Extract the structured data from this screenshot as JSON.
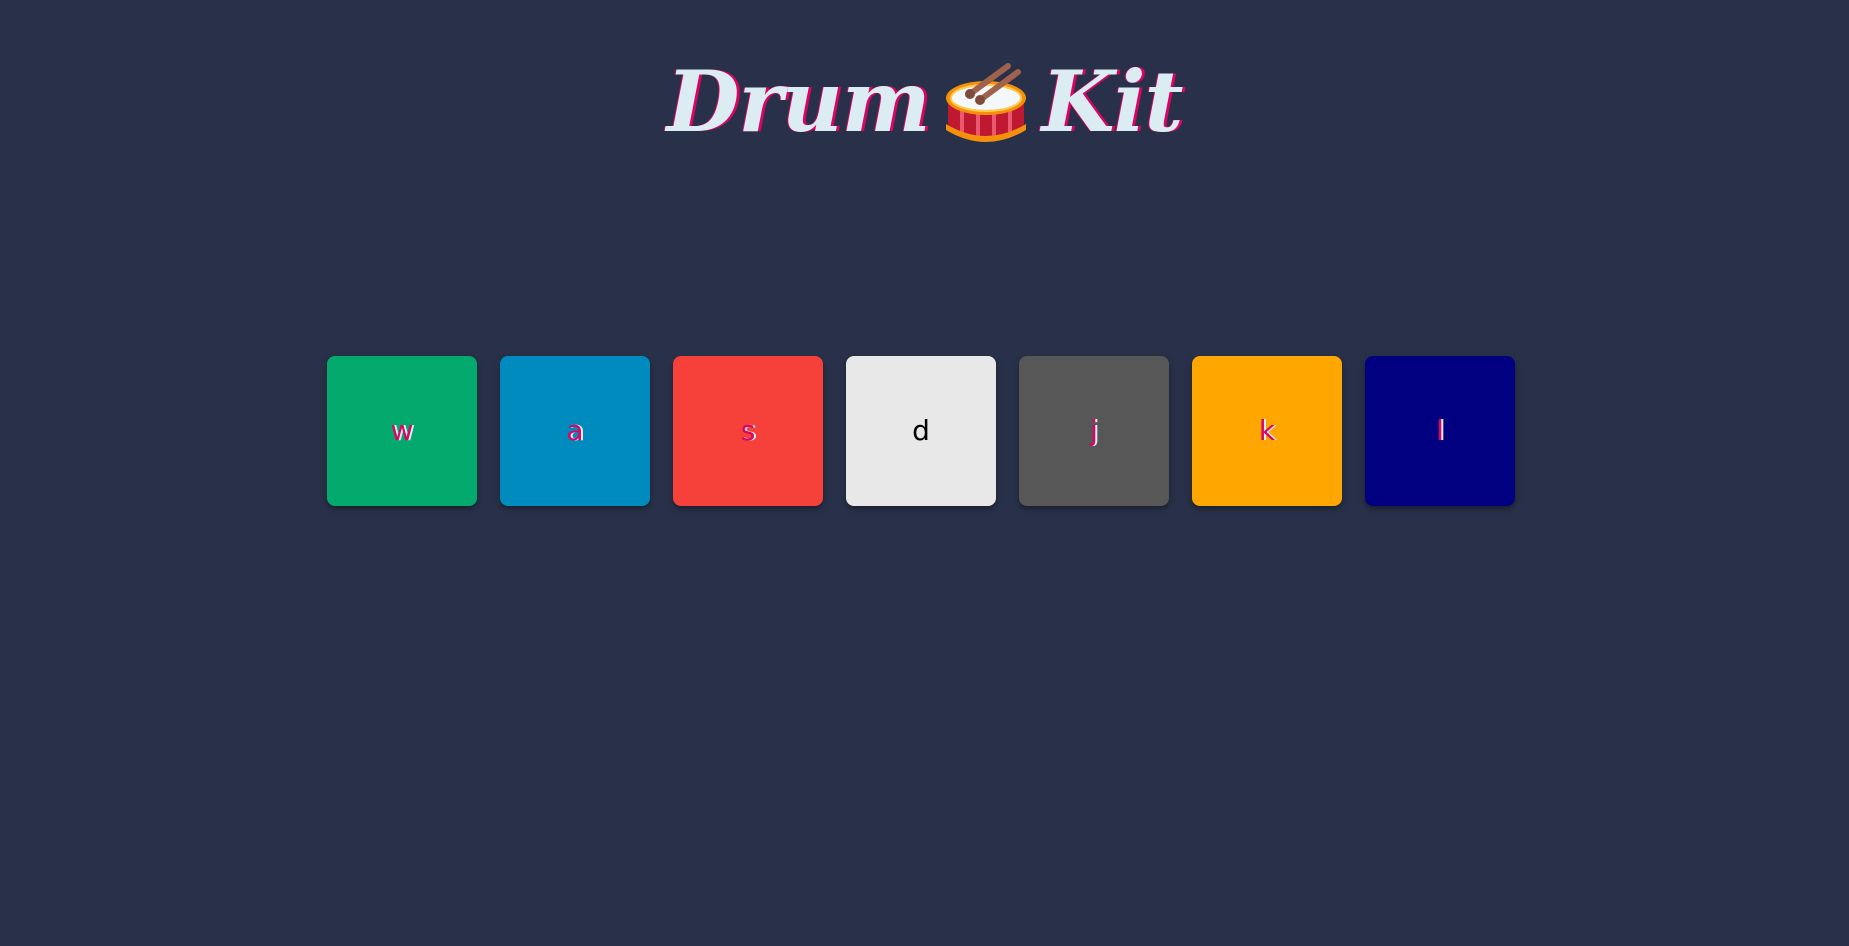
{
  "title": {
    "word1": "Drum",
    "icon": "drum-with-sticks-icon",
    "word2": "Kit"
  },
  "drums": [
    {
      "key": "w",
      "color": "#04a96d"
    },
    {
      "key": "a",
      "color": "#008bbf"
    },
    {
      "key": "s",
      "color": "#f6413a"
    },
    {
      "key": "d",
      "color": "#e8e8e8"
    },
    {
      "key": "j",
      "color": "#575757"
    },
    {
      "key": "k",
      "color": "#ffa600"
    },
    {
      "key": "l",
      "color": "#000080"
    }
  ],
  "colors": {
    "background": "#283149",
    "title_text": "#dbedf3",
    "title_shadow": "#da0463"
  }
}
